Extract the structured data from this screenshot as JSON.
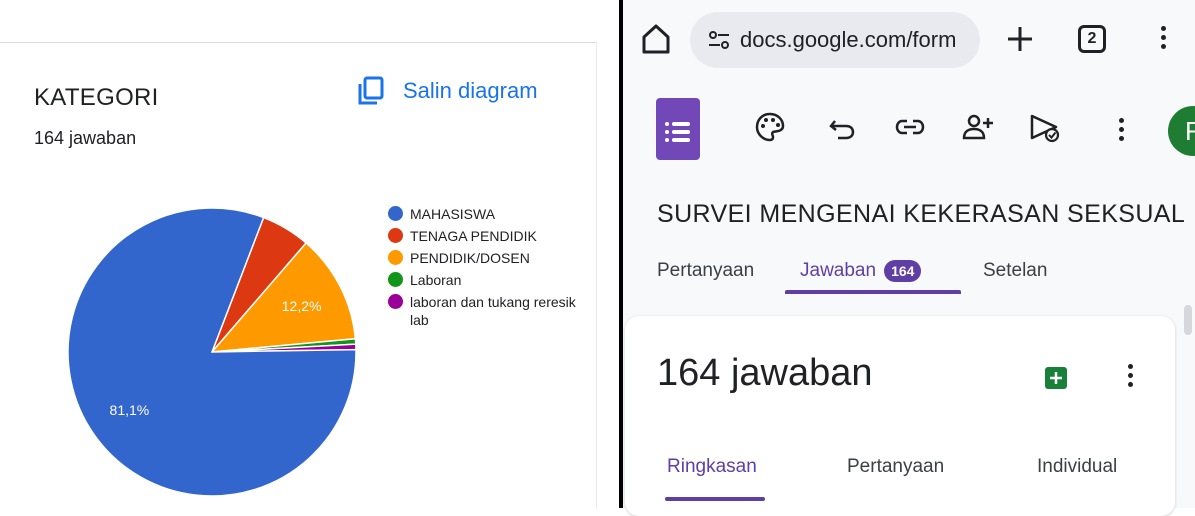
{
  "left_panel": {
    "title": "KATEGORI",
    "subtitle": "164 jawaban",
    "copy_label": "Salin diagram"
  },
  "chart_data": {
    "type": "pie",
    "categories": [
      "MAHASISWA",
      "TENAGA PENDIDIK",
      "PENDIDIK/DOSEN",
      "Laboran",
      "laboran dan tukang reresik lab"
    ],
    "values": [
      81.1,
      5.5,
      12.2,
      0.6,
      0.6
    ],
    "colors": [
      "#3366cc",
      "#dc3912",
      "#ff9900",
      "#109618",
      "#990099"
    ],
    "data_labels": [
      "81,1%",
      "",
      "12,2%",
      "",
      ""
    ],
    "legend_position": "right"
  },
  "browser": {
    "url": "docs.google.com/form",
    "tab_count": "2"
  },
  "forms": {
    "avatar_initial": "F",
    "form_title": "SURVEI MENGENAI KEKERASAN SEKSUAL",
    "tabs": [
      {
        "label": "Pertanyaan"
      },
      {
        "label": "Jawaban",
        "badge": "164"
      },
      {
        "label": "Setelan"
      }
    ],
    "responses_title": "164 jawaban",
    "sub_tabs": [
      "Ringkasan",
      "Pertanyaan",
      "Individual"
    ]
  }
}
